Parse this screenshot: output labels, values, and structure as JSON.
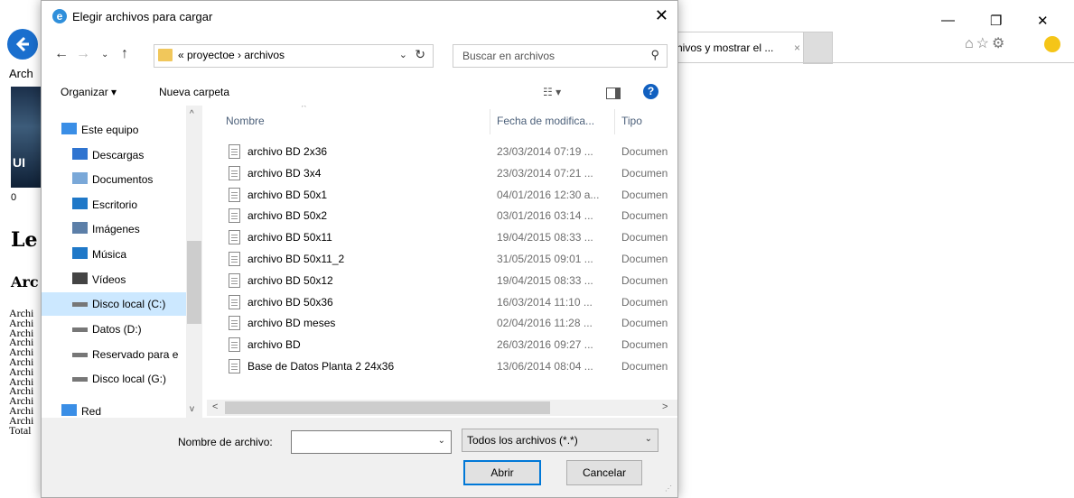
{
  "browser": {
    "tab_title": "hivos y mostrar el ...",
    "tab_close": "×",
    "menu_label": "Arch",
    "logo_text": "UI",
    "counter": "0",
    "heading": "Le",
    "subheading": "Arc",
    "list_items": [
      "Archi",
      "Archi",
      "Archi",
      "Archi",
      "Archi",
      "Archi",
      "Archi",
      "Archi",
      "Archi",
      "Archi",
      "Archi",
      "Archi"
    ],
    "total_label": "Total",
    "win_minimize": "—",
    "win_restore": "❐",
    "win_close": "✕",
    "toolbar_icons": "⌂☆⚙"
  },
  "dialog": {
    "title": "Elegir archivos para cargar",
    "close_glyph": "✕",
    "breadcrumb": "« proyectoe › archivos",
    "search_placeholder": "Buscar en archivos",
    "organize_label": "Organizar ▾",
    "new_folder_label": "Nueva carpeta",
    "nav_items": [
      {
        "label": "Este equipo",
        "icon": "computer-icon"
      },
      {
        "label": "Descargas",
        "icon": "download-icon"
      },
      {
        "label": "Documentos",
        "icon": "documents-icon"
      },
      {
        "label": "Escritorio",
        "icon": "desktop-icon"
      },
      {
        "label": "Imágenes",
        "icon": "pictures-icon"
      },
      {
        "label": "Música",
        "icon": "music-icon"
      },
      {
        "label": "Vídeos",
        "icon": "videos-icon"
      },
      {
        "label": "Disco local (C:)",
        "icon": "drive-icon"
      },
      {
        "label": "Datos (D:)",
        "icon": "drive-icon"
      },
      {
        "label": "Reservado para e",
        "icon": "drive-icon"
      },
      {
        "label": "Disco local (G:)",
        "icon": "drive-icon"
      },
      {
        "label": "Red",
        "icon": "network-icon"
      }
    ],
    "selected_nav": "Disco local (C:)",
    "columns": {
      "name": "Nombre",
      "date": "Fecha de modifica...",
      "type": "Tipo"
    },
    "files": [
      {
        "name": "archivo BD 2x36",
        "date": "23/03/2014 07:19 ...",
        "type": "Documen"
      },
      {
        "name": "archivo BD 3x4",
        "date": "23/03/2014 07:21 ...",
        "type": "Documen"
      },
      {
        "name": "archivo BD 50x1",
        "date": "04/01/2016 12:30 a...",
        "type": "Documen"
      },
      {
        "name": "archivo BD 50x2",
        "date": "03/01/2016 03:14 ...",
        "type": "Documen"
      },
      {
        "name": "archivo BD 50x11",
        "date": "19/04/2015 08:33 ...",
        "type": "Documen"
      },
      {
        "name": "archivo BD 50x11_2",
        "date": "31/05/2015 09:01 ...",
        "type": "Documen"
      },
      {
        "name": "archivo BD 50x12",
        "date": "19/04/2015 08:33 ...",
        "type": "Documen"
      },
      {
        "name": "archivo BD 50x36",
        "date": "16/03/2014 11:10 ...",
        "type": "Documen"
      },
      {
        "name": "archivo BD meses",
        "date": "02/04/2016 11:28 ...",
        "type": "Documen"
      },
      {
        "name": "archivo BD",
        "date": "26/03/2016 09:27 ...",
        "type": "Documen"
      },
      {
        "name": "Base de Datos Planta 2 24x36",
        "date": "13/06/2014 08:04 ...",
        "type": "Documen"
      }
    ],
    "filename_label": "Nombre de archivo:",
    "filename_value": "",
    "filetype_value": "Todos los archivos (*.*)",
    "open_label": "Abrir",
    "cancel_label": "Cancelar"
  }
}
